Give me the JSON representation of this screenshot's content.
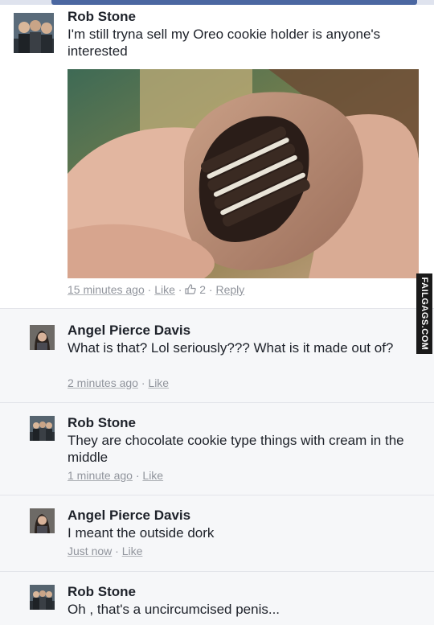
{
  "post": {
    "author": "Rob Stone",
    "text": "I'm still tryna sell my Oreo cookie holder is anyone's interested",
    "meta": {
      "time": "15 minutes ago",
      "sep1": " · ",
      "like": "Like",
      "sep2": " · ",
      "like_count": "2",
      "sep3": " · ",
      "reply": "Reply"
    }
  },
  "comments": [
    {
      "author": "Angel Pierce Davis",
      "text": "What is that? Lol seriously??? What is it made out of?",
      "time": "2 minutes ago",
      "sep": " · ",
      "like": "Like"
    },
    {
      "author": "Rob Stone",
      "text": "They are chocolate cookie type things with cream in the middle",
      "time": "1 minute ago",
      "sep": " · ",
      "like": "Like"
    },
    {
      "author": "Angel Pierce Davis",
      "text": "I meant the outside dork",
      "time": "Just now",
      "sep": " · ",
      "like": "Like"
    },
    {
      "author": "Rob Stone",
      "text": "Oh , that's a uncircumcised penis..."
    }
  ],
  "watermark": "FAILGAGS.COM",
  "colors": {
    "text": "#1d2129",
    "meta": "#90949c",
    "comment_bg": "#f6f7f9",
    "accent": "#4b67a1"
  },
  "icons": {
    "like": "thumbs-up-icon"
  }
}
